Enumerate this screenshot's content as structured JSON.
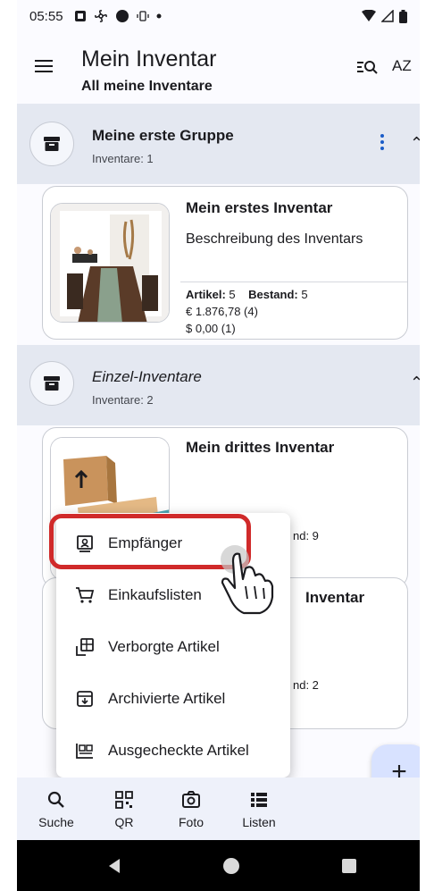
{
  "status": {
    "time": "05:55",
    "icons": [
      "notification-a-icon",
      "fan-icon",
      "circle-icon",
      "vibrate-icon",
      "dot-icon"
    ],
    "right_icons": [
      "wifi-icon",
      "signal-icon",
      "battery-icon"
    ]
  },
  "appbar": {
    "title": "Mein Inventar",
    "subtitle": "All meine Inventare",
    "sort_label": "AZ"
  },
  "groups": [
    {
      "name": "Meine erste Gruppe",
      "count": "Inventare: 1",
      "cards": [
        {
          "title": "Mein erstes Inventar",
          "description": "Beschreibung des Inventars",
          "artikel_label": "Artikel:",
          "artikel_value": "5",
          "bestand_label": "Bestand:",
          "bestand_value": "5",
          "value_eur": "€ 1.876,78 (4)",
          "value_usd": "$ 0,00 (1)"
        }
      ]
    },
    {
      "name": "Einzel-Inventare",
      "count": "Inventare: 2",
      "cards": [
        {
          "title": "Mein drittes Inventar",
          "stats_partial": "nd: 9"
        },
        {
          "title": "Inventar",
          "stats_partial": "nd: 2"
        }
      ]
    }
  ],
  "popup_menu": {
    "items": [
      {
        "label": "Empfänger",
        "icon": "recipient-icon"
      },
      {
        "label": "Einkaufslisten",
        "icon": "shopping-cart-icon"
      },
      {
        "label": "Verborgte Artikel",
        "icon": "lent-items-icon"
      },
      {
        "label": "Archivierte Artikel",
        "icon": "archive-icon"
      },
      {
        "label": "Ausgecheckte Artikel",
        "icon": "checked-out-icon"
      }
    ]
  },
  "fab": {
    "label": "+"
  },
  "bottom_nav": {
    "items": [
      {
        "label": "Suche",
        "icon": "search-icon"
      },
      {
        "label": "QR",
        "icon": "qr-icon"
      },
      {
        "label": "Foto",
        "icon": "camera-icon"
      },
      {
        "label": "Listen",
        "icon": "list-icon"
      }
    ]
  },
  "colors": {
    "accent": "#1a5cc8",
    "group_background": "#e4e8f1",
    "highlight_border": "#d02a2a",
    "fab_background": "#d8e2ff",
    "nav_background": "#eef1fa"
  }
}
